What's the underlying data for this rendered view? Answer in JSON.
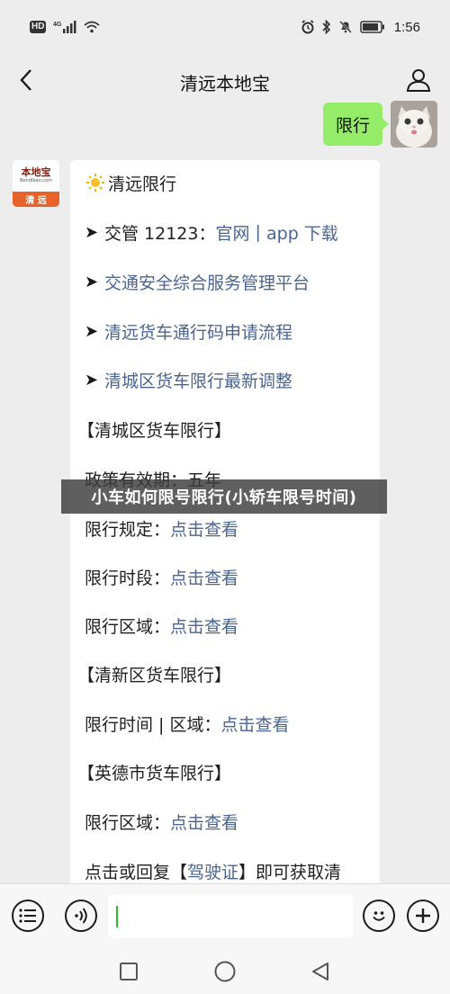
{
  "status_bar": {
    "left_badges": [
      "HD",
      "4G"
    ],
    "time": "1:56"
  },
  "nav": {
    "title": "清远本地宝"
  },
  "user_message": {
    "text": "限行"
  },
  "bot_avatar": {
    "brand": "本地宝",
    "url": "Bendibao.com",
    "city": "清 远"
  },
  "bot_message": {
    "header": "清远限行",
    "links": [
      {
        "prefix": "交管 12123：",
        "parts": [
          "官网",
          " | ",
          "app 下载"
        ]
      },
      {
        "prefix": "",
        "parts": [
          "交通安全综合服务管理平台"
        ]
      },
      {
        "prefix": "",
        "parts": [
          "清远货车通行码申请流程"
        ]
      },
      {
        "prefix": "",
        "parts": [
          "清城区货车限行最新调整"
        ]
      }
    ],
    "sections": [
      {
        "title": "【清城区货车限行】",
        "items": [
          {
            "label": "政策有效期：",
            "value": "五年",
            "is_link": false
          },
          {
            "label": "限行规定：",
            "value": "点击查看",
            "is_link": true
          },
          {
            "label": "限行时段：",
            "value": "点击查看",
            "is_link": true
          },
          {
            "label": "限行区域：",
            "value": "点击查看",
            "is_link": true
          }
        ]
      },
      {
        "title": "【清新区货车限行】",
        "items": [
          {
            "label": "限行时间 | 区域：",
            "value": "点击查看",
            "is_link": true
          }
        ]
      },
      {
        "title": "【英德市货车限行】",
        "items": [
          {
            "label": "限行区域：",
            "value": "点击查看",
            "is_link": true
          }
        ]
      }
    ],
    "footer": {
      "before": "点击或回复【",
      "link": "驾驶证",
      "after": "】即可获取清"
    }
  },
  "caption": "小车如何限号限行(小轿车限号时间)",
  "colors": {
    "background": "#ededed",
    "user_bubble": "#95ec69",
    "link": "#4b6590",
    "cursor": "#2eb82e",
    "brand_orange": "#e8632a"
  },
  "icons": {
    "back": "chevron-left-icon",
    "profile": "person-icon",
    "menu": "list-menu-icon",
    "voice": "voice-icon",
    "emoji": "smiley-icon",
    "add": "plus-icon"
  }
}
